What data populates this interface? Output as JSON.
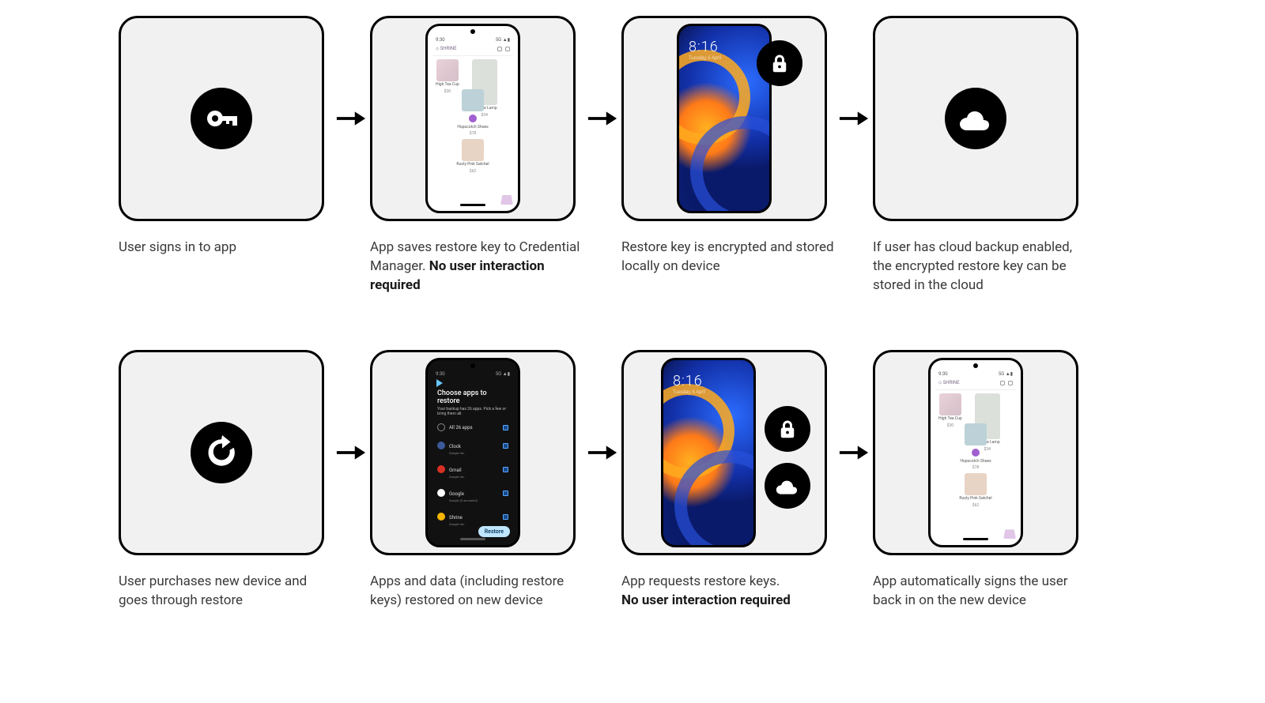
{
  "row1": {
    "step1": {
      "caption": "User signs in to app"
    },
    "step2": {
      "caption_pre": "App saves restore key to Credential Manager. ",
      "caption_bold": "No user interaction required",
      "phone": {
        "status_left": "9:30",
        "status_right": "5G ▲▮",
        "app_title": "⬦ SHRINE",
        "products": {
          "p1": {
            "name": "High Tea Cup",
            "price": "$30"
          },
          "p2": {
            "name": "3K Olive Lamp",
            "price": "$34"
          },
          "p3": {
            "name": "Hopscotch Shoes",
            "price": "$78"
          },
          "p4": {
            "name": "Rusty Pink Satchel",
            "price": "$62"
          }
        }
      }
    },
    "step3": {
      "caption": "Restore key is encrypted and stored locally on device",
      "lock": {
        "time": "8:16",
        "date": "Tuesday, 6 April"
      }
    },
    "step4": {
      "caption": "If user has cloud backup enabled, the encrypted restore key can be stored in the cloud"
    }
  },
  "row2": {
    "step1": {
      "caption": "User purchases new device and goes through restore"
    },
    "step2": {
      "caption": "Apps and data (including restore keys) restored on new device",
      "phone": {
        "status_left": "9:30",
        "status_right": "5G ▲▮",
        "title": "Choose apps to restore",
        "sub": "Your backup has 26 apps. Pick a few or bring them all.",
        "all": "All 26 apps",
        "items": {
          "i1": {
            "name": "Clock",
            "sub": "Google Inc."
          },
          "i2": {
            "name": "Gmail",
            "sub": "Google Inc."
          },
          "i3": {
            "name": "Google",
            "sub": "Google (3 accounts)"
          },
          "i4": {
            "name": "Shrine",
            "sub": "Google Inc."
          }
        },
        "btn": "Restore"
      }
    },
    "step3": {
      "caption_pre": "App requests restore keys.",
      "caption_bold": "No user interaction required",
      "lock": {
        "time": "8:16",
        "date": "Tuesday, 6 April"
      }
    },
    "step4": {
      "caption": "App automatically signs the user back in on the new device",
      "phone": {
        "status_left": "9:30",
        "status_right": "5G ▲▮",
        "app_title": "⬦ SHRINE",
        "products": {
          "p1": {
            "name": "High Tea Cup",
            "price": "$30"
          },
          "p2": {
            "name": "3K Olive Lamp",
            "price": "$34"
          },
          "p3": {
            "name": "Hopscotch Shoes",
            "price": "$78"
          },
          "p4": {
            "name": "Rusty Pink Satchel",
            "price": "$62"
          }
        }
      }
    }
  }
}
